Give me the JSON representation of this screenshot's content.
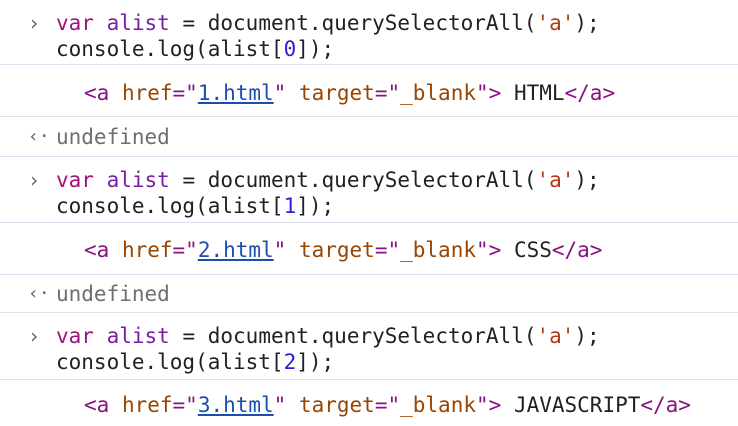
{
  "entries": [
    {
      "input": {
        "kw": "var",
        "varname": "alist",
        "eq": " = document.querySelectorAll(",
        "str": "'a'",
        "end": ");",
        "line2_pre": "console.log(alist[",
        "index": "0",
        "line2_post": "]);"
      },
      "log": {
        "open": "<a ",
        "href_attr": "href",
        "eq_q": "=\"",
        "href_val": "1.html",
        "close_q": "\" ",
        "target_attr": "target",
        "target_eq": "=\"",
        "target_val": "_blank",
        "target_close": "\"",
        "gt": ">",
        "text": " HTML",
        "close_tag": "</a>"
      },
      "result": "undefined"
    },
    {
      "input": {
        "kw": "var",
        "varname": "alist",
        "eq": " = document.querySelectorAll(",
        "str": "'a'",
        "end": ");",
        "line2_pre": "console.log(alist[",
        "index": "1",
        "line2_post": "]);"
      },
      "log": {
        "open": "<a ",
        "href_attr": "href",
        "eq_q": "=\"",
        "href_val": "2.html",
        "close_q": "\" ",
        "target_attr": "target",
        "target_eq": "=\"",
        "target_val": "_blank",
        "target_close": "\"",
        "gt": ">",
        "text": " CSS",
        "close_tag": "</a>"
      },
      "result": "undefined"
    },
    {
      "input": {
        "kw": "var",
        "varname": "alist",
        "eq": " = document.querySelectorAll(",
        "str": "'a'",
        "end": ");",
        "line2_pre": "console.log(alist[",
        "index": "2",
        "line2_post": "]);"
      },
      "log": {
        "open": "<a ",
        "href_attr": "href",
        "eq_q": "=\"",
        "href_val": "3.html",
        "close_q": "\" ",
        "target_attr": "target",
        "target_eq": "=\"",
        "target_val": "_blank",
        "target_close": "\"",
        "gt": ">",
        "text": " JAVASCRIPT",
        "close_tag": "</a>"
      }
    }
  ],
  "icons": {
    "input_prompt": "›",
    "result_prompt": "‹·"
  },
  "colors": {
    "divider": "#d9e2f1",
    "keyword": "#a1127e",
    "string": "#b13a16",
    "number": "#2a1fd6",
    "tag": "#881280",
    "attribute": "#994500",
    "link": "#1a4fb0",
    "muted": "#6e6e6e"
  }
}
